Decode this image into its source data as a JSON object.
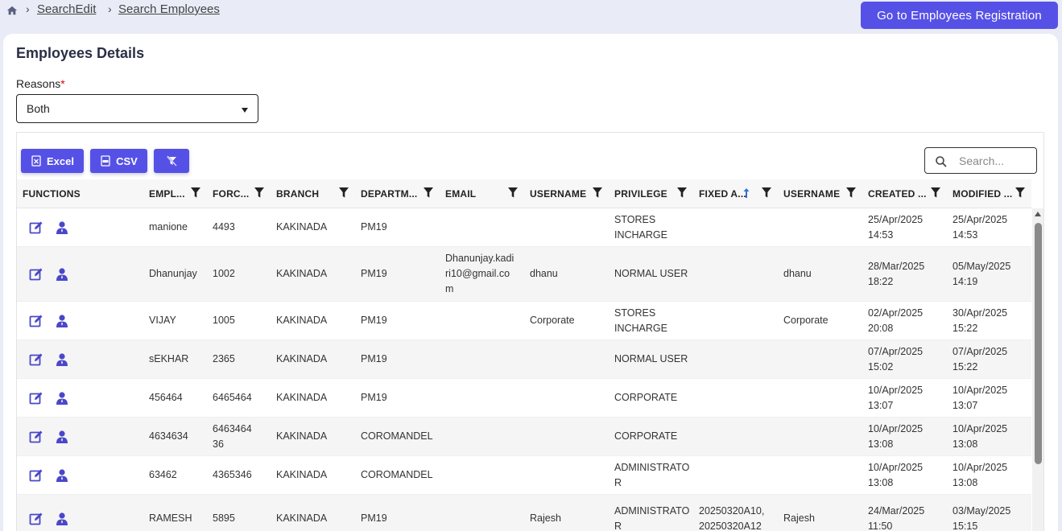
{
  "breadcrumb": {
    "home_icon": "home-icon",
    "items": [
      "SearchEdit",
      "Search Employees"
    ]
  },
  "header": {
    "registration_button": "Go to  Employees Registration"
  },
  "page": {
    "title": "Employees Details",
    "reasons_label": "Reasons",
    "required_mark": "*",
    "reasons_value": "Both"
  },
  "toolbar": {
    "excel_label": "Excel",
    "csv_label": "CSV",
    "search_placeholder": "Search..."
  },
  "accent_color": "#5651e6",
  "columns": [
    "FUNCTIONS",
    "EMPL...",
    "FORC...",
    "BRANCH",
    "DEPARTM...",
    "EMAIL",
    "USERNAME",
    "PRIVILEGE",
    "FIXED A...",
    "USERNAME",
    "CREATED ...",
    "MODIFIED ..."
  ],
  "rows": [
    {
      "emp": "manione",
      "force": "4493",
      "branch": "KAKINADA",
      "dept": "PM19",
      "email": [
        "",
        "",
        ""
      ],
      "username": "",
      "privilege": [
        "STORES",
        "INCHARGE"
      ],
      "fixed": [
        "",
        ""
      ],
      "username2": "",
      "created": [
        "25/Apr/2025",
        "14:53"
      ],
      "modified": [
        "25/Apr/2025",
        "14:53"
      ]
    },
    {
      "emp": "Dhanunjay",
      "force": "1002",
      "branch": "KAKINADA",
      "dept": "PM19",
      "email": [
        "Dhanunjay.kadi",
        "ri10@gmail.co",
        "m"
      ],
      "username": "dhanu",
      "privilege": [
        "NORMAL USER",
        ""
      ],
      "fixed": [
        "",
        ""
      ],
      "username2": "dhanu",
      "created": [
        "28/Mar/2025",
        "18:22"
      ],
      "modified": [
        "05/May/2025",
        "14:19"
      ]
    },
    {
      "emp": "VIJAY",
      "force": "1005",
      "branch": "KAKINADA",
      "dept": "PM19",
      "email": [
        "",
        "",
        ""
      ],
      "username": "Corporate",
      "privilege": [
        "STORES",
        "INCHARGE"
      ],
      "fixed": [
        "",
        ""
      ],
      "username2": "Corporate",
      "created": [
        "02/Apr/2025",
        "20:08"
      ],
      "modified": [
        "30/Apr/2025",
        "15:22"
      ]
    },
    {
      "emp": "sEKHAR",
      "force": "2365",
      "branch": "KAKINADA",
      "dept": "PM19",
      "email": [
        "",
        "",
        ""
      ],
      "username": "",
      "privilege": [
        "NORMAL USER",
        ""
      ],
      "fixed": [
        "",
        ""
      ],
      "username2": "",
      "created": [
        "07/Apr/2025",
        "15:02"
      ],
      "modified": [
        "07/Apr/2025",
        "15:22"
      ]
    },
    {
      "emp": "456464",
      "force": "6465464",
      "branch": "KAKINADA",
      "dept": "PM19",
      "email": [
        "",
        "",
        ""
      ],
      "username": "",
      "privilege": [
        "CORPORATE",
        ""
      ],
      "fixed": [
        "",
        ""
      ],
      "username2": "",
      "created": [
        "10/Apr/2025",
        "13:07"
      ],
      "modified": [
        "10/Apr/2025",
        "13:07"
      ]
    },
    {
      "emp": "4634634",
      "force": "6463464\n36",
      "branch": "KAKINADA",
      "dept": "COROMANDEL",
      "email": [
        "",
        "",
        ""
      ],
      "username": "",
      "privilege": [
        "CORPORATE",
        ""
      ],
      "fixed": [
        "",
        ""
      ],
      "username2": "",
      "created": [
        "10/Apr/2025",
        "13:08"
      ],
      "modified": [
        "10/Apr/2025",
        "13:08"
      ]
    },
    {
      "emp": "63462",
      "force": "4365346",
      "branch": "KAKINADA",
      "dept": "COROMANDEL",
      "email": [
        "",
        "",
        ""
      ],
      "username": "",
      "privilege": [
        "ADMINISTRATO",
        "R"
      ],
      "fixed": [
        "",
        ""
      ],
      "username2": "",
      "created": [
        "10/Apr/2025",
        "13:08"
      ],
      "modified": [
        "10/Apr/2025",
        "13:08"
      ]
    },
    {
      "emp": "RAMESH",
      "force": "5895",
      "branch": "KAKINADA",
      "dept": "PM19",
      "email": [
        "",
        "",
        ""
      ],
      "username": "Rajesh",
      "privilege": [
        "ADMINISTRATO",
        "R"
      ],
      "fixed": [
        "20250320A10,",
        "20250320A12"
      ],
      "username2": "Rajesh",
      "created": [
        "24/Mar/2025",
        "11:50"
      ],
      "modified": [
        "03/May/2025",
        "15:15"
      ]
    }
  ]
}
